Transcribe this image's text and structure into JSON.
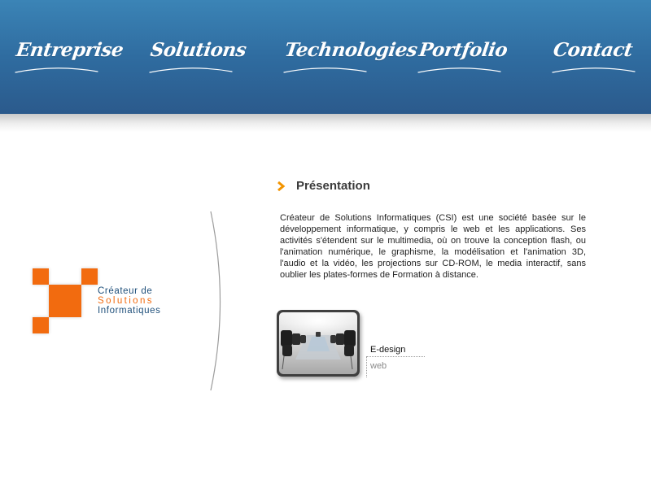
{
  "nav": {
    "items": [
      {
        "label": "Entreprise"
      },
      {
        "label": "Solutions"
      },
      {
        "label": "Technologies"
      },
      {
        "label": "Portfolio"
      },
      {
        "label": "Contact"
      }
    ]
  },
  "logo": {
    "line1": "Créateur de",
    "line2": "Solutions",
    "line3": "Informatiques"
  },
  "content": {
    "title": "Présentation",
    "paragraph": "Créateur de Solutions Informatiques (CSI) est une société basée sur le développement informatique, y compris le web et les applications. Ses activités s'étendent sur le multimedia, où on trouve la conception flash, ou l'animation numérique, le graphisme, la modélisation et l'animation 3D, l'audio et la vidéo, les projections sur CD-ROM, le media interactif, sans oublier les plates-formes de Formation à distance."
  },
  "portfolio_item": {
    "title": "E-design",
    "subtitle": "web"
  },
  "colors": {
    "header_blue": "#2f6ca0",
    "brand_orange": "#f26b0f",
    "logo_blue": "#1e4f7a",
    "chevron_orange": "#f29400"
  },
  "icons": {
    "title_chevron": "chevron-right-icon"
  }
}
